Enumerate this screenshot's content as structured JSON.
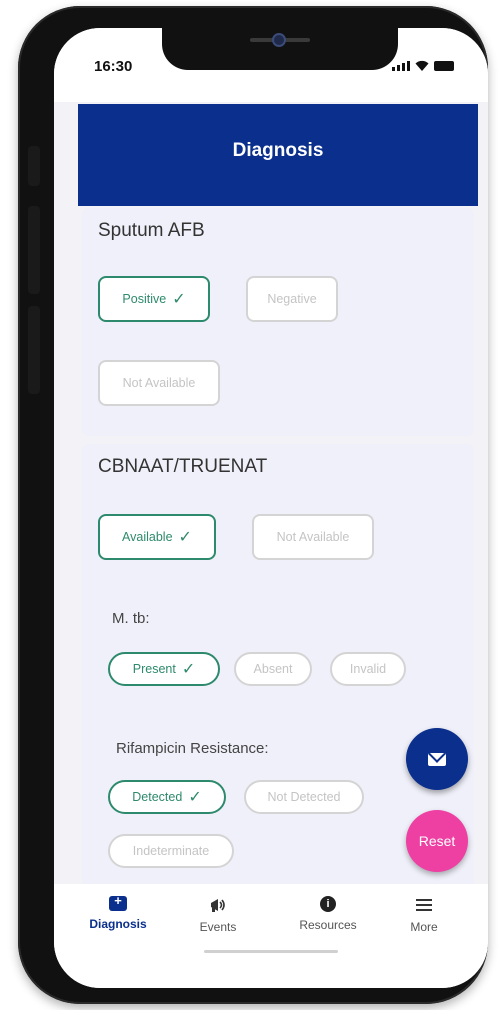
{
  "status_bar": {
    "time": "16:30"
  },
  "header": {
    "title": "Diagnosis"
  },
  "sputum": {
    "title": "Sputum AFB",
    "options": {
      "positive": "Positive",
      "negative": "Negative",
      "not_available": "Not Available"
    },
    "selected": "Positive"
  },
  "cbnaat": {
    "title": "CBNAAT/TRUENAT",
    "options": {
      "available": "Available",
      "not_available": "Not Available"
    },
    "selected": "Available",
    "mtb": {
      "label": "M. tb:",
      "options": {
        "present": "Present",
        "absent": "Absent",
        "invalid": "Invalid"
      },
      "selected": "Present"
    },
    "rif": {
      "label": "Rifampicin Resistance:",
      "options": {
        "detected": "Detected",
        "not_detected": "Not Detected",
        "indeterminate": "Indeterminate"
      },
      "selected": "Detected"
    }
  },
  "fab": {
    "reset_label": "Reset"
  },
  "bottom_nav": {
    "diagnosis": "Diagnosis",
    "events": "Events",
    "resources": "Resources",
    "more": "More"
  },
  "colors": {
    "primary": "#0a2f8c",
    "accent_green": "#2e8a6c",
    "reset_pink": "#ee3fa3"
  }
}
